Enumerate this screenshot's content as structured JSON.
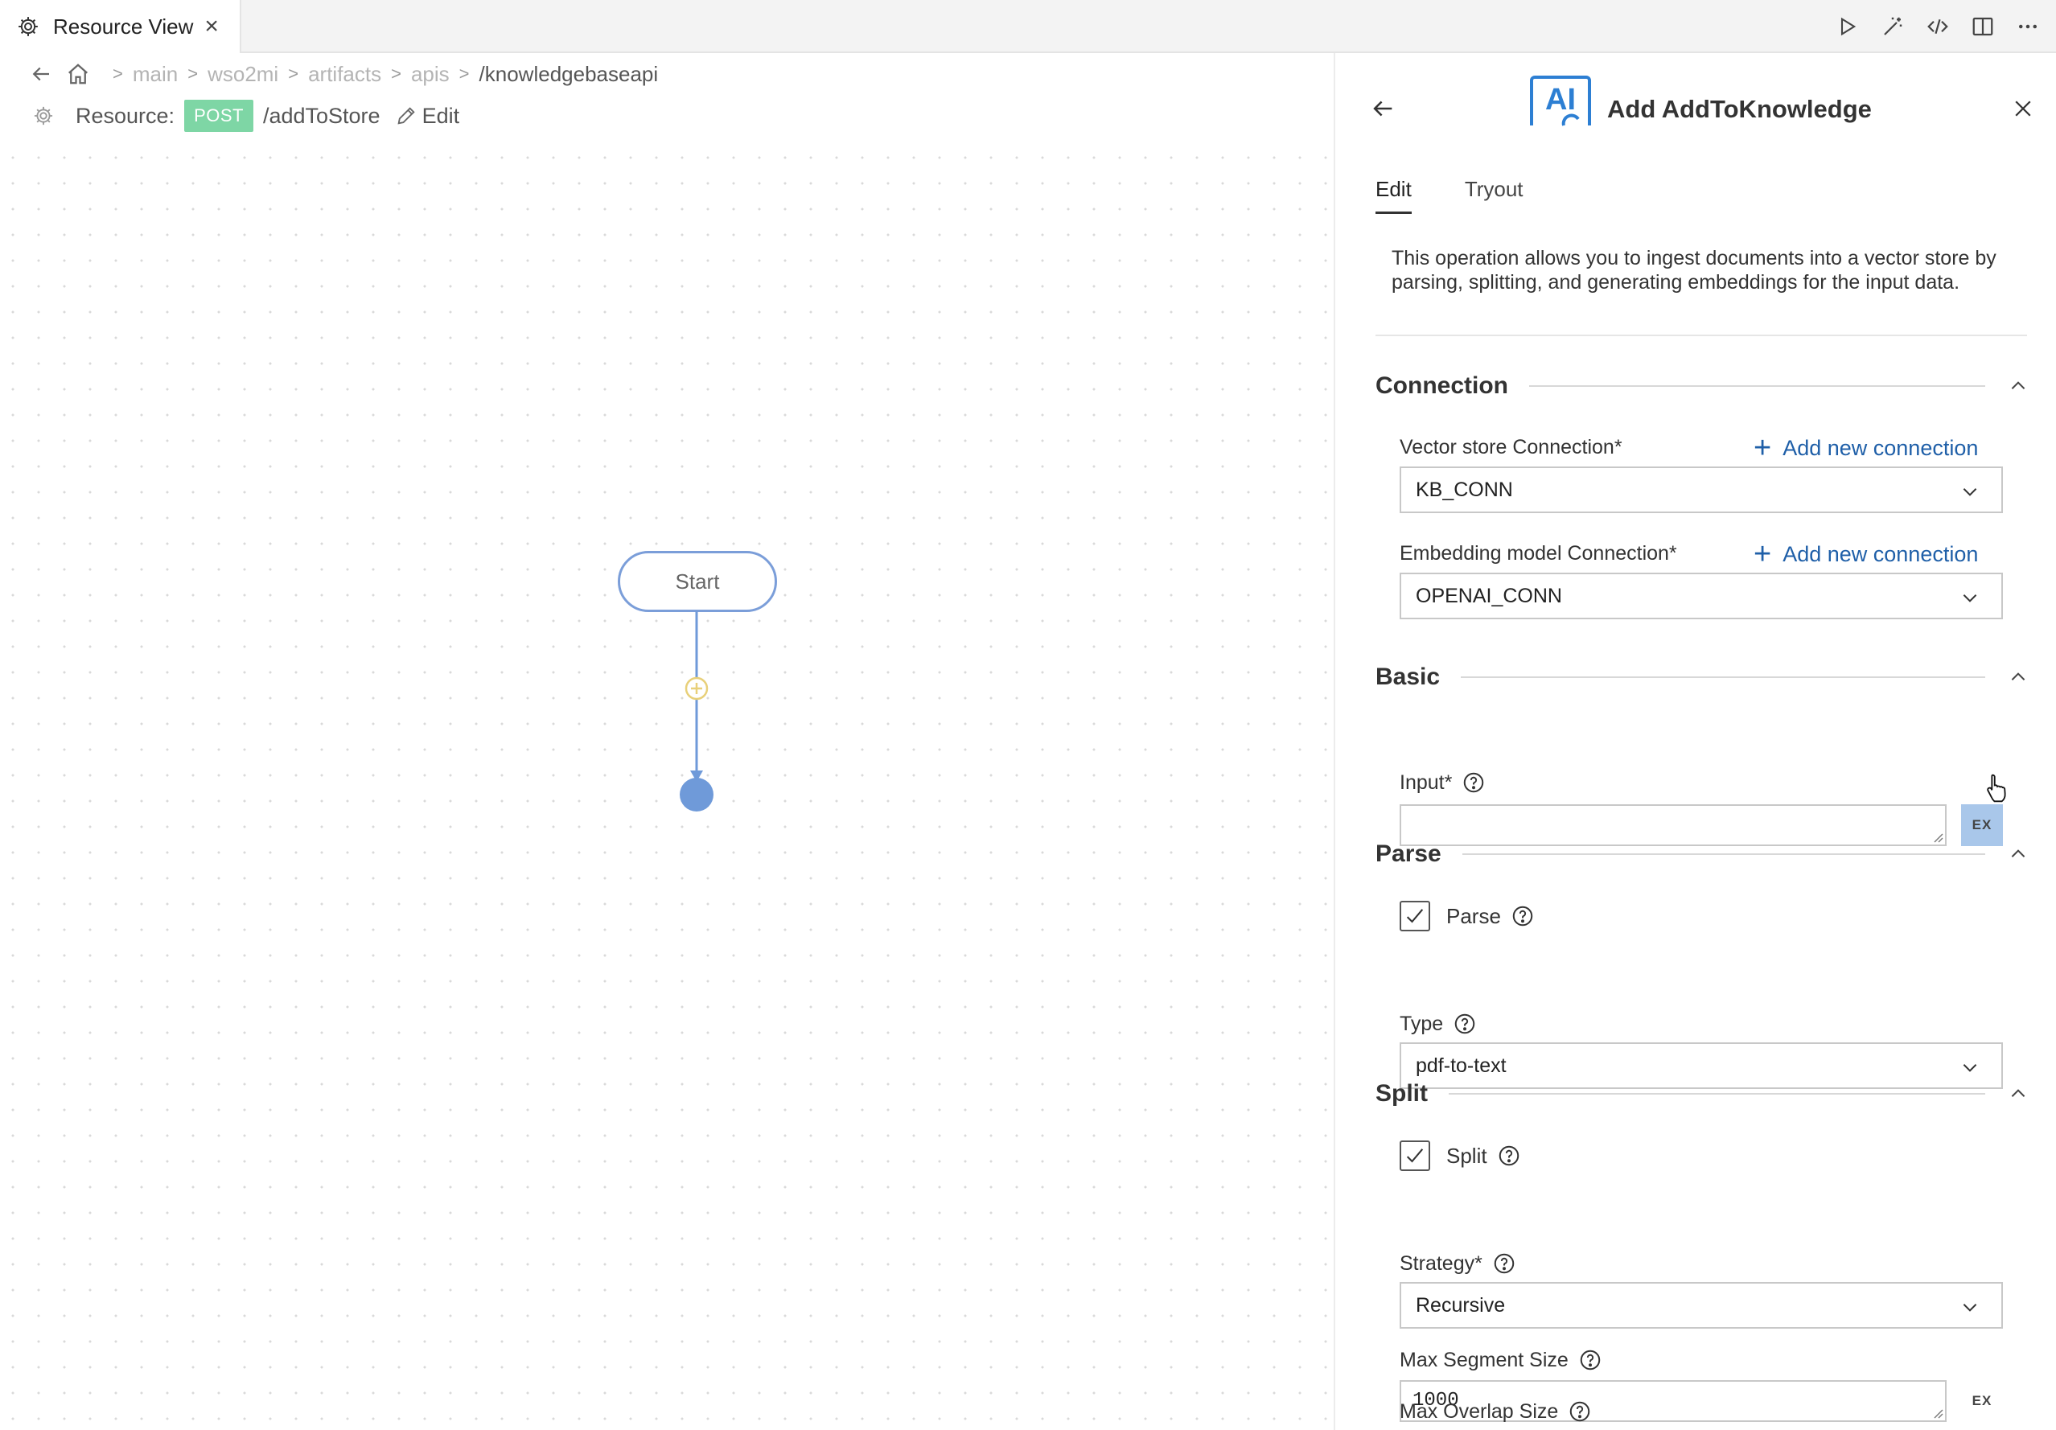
{
  "tab": {
    "title": "Resource View"
  },
  "breadcrumb": {
    "items": [
      "main",
      "wso2mi",
      "artifacts",
      "apis"
    ],
    "current": "/knowledgebaseapi"
  },
  "resource": {
    "label": "Resource:",
    "method": "POST",
    "path": "/addToStore",
    "edit_label": "Edit"
  },
  "canvas": {
    "start_label": "Start"
  },
  "panel": {
    "logo_text": "AI",
    "title": "Add AddToKnowledge",
    "tabs": [
      "Edit",
      "Tryout"
    ],
    "description": "This operation allows you to ingest documents into a vector store by parsing, splitting, and generating embeddings for the input data.",
    "connection": {
      "title": "Connection",
      "vector_label": "Vector store Connection*",
      "vector_value": "KB_CONN",
      "embedding_label": "Embedding model Connection*",
      "embedding_value": "OPENAI_CONN",
      "add_new_label": "Add new connection"
    },
    "basic": {
      "title": "Basic",
      "input_label": "Input*",
      "input_value": "",
      "ex_label": "EX"
    },
    "parse": {
      "title": "Parse",
      "checkbox_label": "Parse",
      "checked": true,
      "type_label": "Type",
      "type_value": "pdf-to-text"
    },
    "split": {
      "title": "Split",
      "checkbox_label": "Split",
      "checked": true,
      "strategy_label": "Strategy*",
      "strategy_value": "Recursive",
      "max_segment_label": "Max Segment Size",
      "max_segment_value": "1000",
      "max_overlap_label": "Max Overlap Size",
      "ex_label": "EX"
    }
  },
  "colors": {
    "post_badge": "#7ed6a5",
    "link": "#1f5fa8",
    "node_border": "#7b9ed9",
    "end_node": "#6f9ad9"
  }
}
